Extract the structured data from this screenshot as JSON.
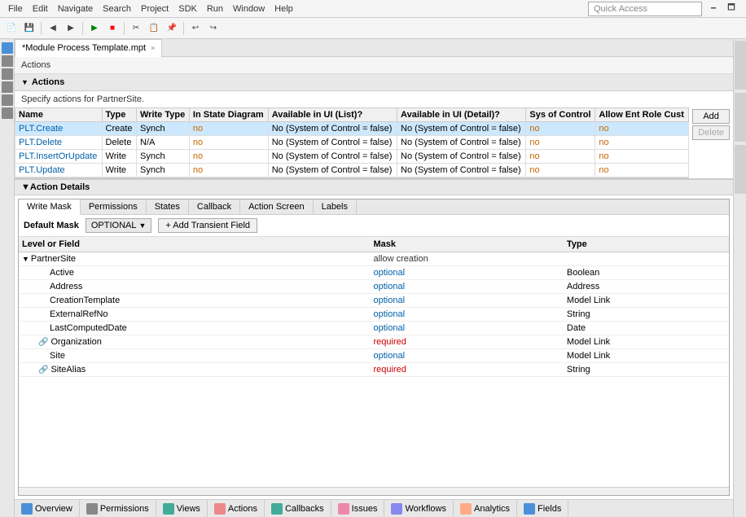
{
  "menu": {
    "items": [
      "File",
      "Edit",
      "Navigate",
      "Search",
      "Project",
      "SDK",
      "Run",
      "Window",
      "Help"
    ]
  },
  "quick_access": {
    "label": "Quick Access",
    "placeholder": "Quick Access"
  },
  "tab": {
    "title": "*Module Process Template.mpt",
    "close": "×"
  },
  "section": {
    "actions_label": "Actions",
    "collapse_label": "Actions",
    "specify_text": "Specify actions for PartnerSite.",
    "add_btn": "Add",
    "delete_btn": "Delete"
  },
  "table": {
    "headers": [
      "Name",
      "Type",
      "Write Type",
      "In State Diagram",
      "Available in UI (List)?",
      "Available in UI (Detail)?",
      "Sys of Control",
      "Allow Ent Role Cust"
    ],
    "rows": [
      {
        "name": "PLT.Create",
        "type": "Create",
        "write_type": "Synch",
        "in_state": "no",
        "avail_list": "No (System of Control = false)",
        "avail_detail": "No (System of Control = false)",
        "sys_control": "no",
        "allow": "no",
        "selected": true
      },
      {
        "name": "PLT.Delete",
        "type": "Delete",
        "write_type": "N/A",
        "in_state": "no",
        "avail_list": "No (System of Control = false)",
        "avail_detail": "No (System of Control = false)",
        "sys_control": "no",
        "allow": "no",
        "selected": false
      },
      {
        "name": "PLT.InsertOrUpdate",
        "type": "Write",
        "write_type": "Synch",
        "in_state": "no",
        "avail_list": "No (System of Control = false)",
        "avail_detail": "No (System of Control = false)",
        "sys_control": "no",
        "allow": "no",
        "selected": false
      },
      {
        "name": "PLT.Update",
        "type": "Write",
        "write_type": "Synch",
        "in_state": "no",
        "avail_list": "No (System of Control = false)",
        "avail_detail": "No (System of Control = false)",
        "sys_control": "no",
        "allow": "no",
        "selected": false
      }
    ]
  },
  "action_details": {
    "label": "Action Details"
  },
  "inner_tabs": {
    "tabs": [
      "Write Mask",
      "Permissions",
      "States",
      "Callback",
      "Action Screen",
      "Labels"
    ],
    "active": "Write Mask"
  },
  "mask": {
    "default_label": "Default Mask",
    "optional_btn": "OPTIONAL",
    "add_field_btn": "+ Add Transient Field"
  },
  "field_table": {
    "headers": [
      "Level or Field",
      "Mask",
      "Type"
    ],
    "rows": [
      {
        "indent": 0,
        "icon": "arrow",
        "name": "PartnerSite",
        "mask": "allow creation",
        "type": "",
        "has_arrow": true
      },
      {
        "indent": 1,
        "icon": "",
        "name": "Active",
        "mask": "optional",
        "type": "Boolean"
      },
      {
        "indent": 1,
        "icon": "",
        "name": "Address",
        "mask": "optional",
        "type": "Address"
      },
      {
        "indent": 1,
        "icon": "",
        "name": "CreationTemplate",
        "mask": "optional",
        "type": "Model Link"
      },
      {
        "indent": 1,
        "icon": "",
        "name": "ExternalRefNo",
        "mask": "optional",
        "type": "String"
      },
      {
        "indent": 1,
        "icon": "",
        "name": "LastComputedDate",
        "mask": "optional",
        "type": "Date"
      },
      {
        "indent": 1,
        "icon": "link",
        "name": "Organization",
        "mask": "required",
        "type": "Model Link"
      },
      {
        "indent": 1,
        "icon": "",
        "name": "Site",
        "mask": "optional",
        "type": "Model Link"
      },
      {
        "indent": 1,
        "icon": "link",
        "name": "SiteAlias",
        "mask": "required",
        "type": "String"
      }
    ]
  },
  "bottom_tabs": [
    {
      "icon": "overview",
      "label": "Overview",
      "color": "#4a90d9"
    },
    {
      "icon": "permissions",
      "label": "Permissions",
      "color": "#888"
    },
    {
      "icon": "views",
      "label": "Views",
      "color": "#4a9"
    },
    {
      "icon": "actions",
      "label": "Actions",
      "color": "#e88"
    },
    {
      "icon": "callbacks",
      "label": "Callbacks",
      "color": "#4a9"
    },
    {
      "icon": "issues",
      "label": "Issues",
      "color": "#e8a"
    },
    {
      "icon": "workflows",
      "label": "Workflows",
      "color": "#88e"
    },
    {
      "icon": "analytics",
      "label": "Analytics",
      "color": "#fa8"
    },
    {
      "icon": "fields",
      "label": "Fields",
      "color": "#4a90d9"
    }
  ]
}
